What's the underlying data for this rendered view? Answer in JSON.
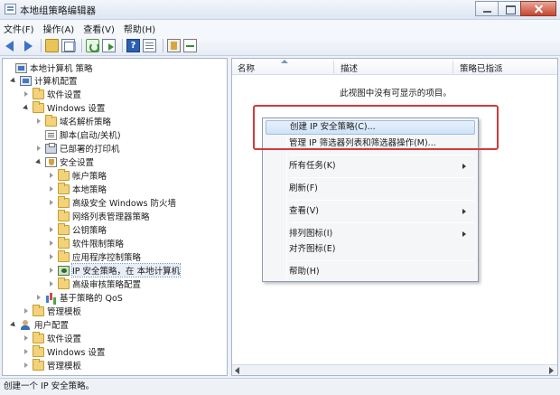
{
  "window": {
    "title": "本地组策略编辑器"
  },
  "menubar": {
    "items": [
      "文件(F)",
      "操作(A)",
      "查看(V)",
      "帮助(H)"
    ]
  },
  "tree": {
    "root": "本地计算机 策略",
    "computer_config": "计算机配置",
    "software_settings": "软件设置",
    "windows_settings": "Windows 设置",
    "name_resolution": "域名解析策略",
    "scripts": "脚本(启动/关机)",
    "deployed_printers": "已部署的打印机",
    "security_settings": "安全设置",
    "account_policies": "帐户策略",
    "local_policies": "本地策略",
    "firewall": "高级安全 Windows 防火墙",
    "network_list": "网络列表管理器策略",
    "public_key": "公钥策略",
    "software_restriction": "软件限制策略",
    "app_control": "应用程序控制策略",
    "ipsec": "IP 安全策略，在 本地计算机",
    "audit": "高级审核策略配置",
    "qos": "基于策略的 QoS",
    "admin_templates": "管理模板",
    "user_config": "用户配置",
    "user_software_settings": "软件设置",
    "user_windows_settings": "Windows 设置",
    "user_admin_templates": "管理模板"
  },
  "list": {
    "columns": [
      "名称",
      "描述",
      "策略已指派"
    ],
    "empty_message": "此视图中没有可显示的项目。"
  },
  "context_menu": {
    "items": [
      {
        "label": "创建 IP 安全策略(C)...",
        "highlighted": true
      },
      {
        "label": "管理 IP 筛选器列表和筛选器操作(M)..."
      },
      {
        "label": "所有任务(K)",
        "submenu": true
      },
      {
        "label": "刷新(F)"
      },
      {
        "label": "查看(V)",
        "submenu": true
      },
      {
        "label": "排列图标(I)",
        "submenu": true
      },
      {
        "label": "对齐图标(E)"
      },
      {
        "label": "帮助(H)"
      }
    ]
  },
  "statusbar": {
    "text": "创建一个 IP 安全策略。"
  },
  "colors": {
    "highlight_box": "#d23a3a",
    "menu_highlight": "#cfe2f8"
  }
}
